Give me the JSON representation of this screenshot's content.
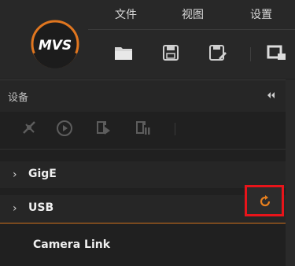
{
  "app": {
    "logo_text": "MVS"
  },
  "menu": {
    "file": "文件",
    "view": "视图",
    "settings": "设置"
  },
  "toolbar": {
    "icons": [
      "open-folder-icon",
      "save-icon",
      "save-as-icon",
      "window-icon"
    ]
  },
  "device_panel": {
    "title": "设备",
    "tools": [
      "disconnect-icon",
      "play-icon",
      "acquire-icon",
      "stop-acquire-icon"
    ],
    "tree": [
      {
        "label": "GigE",
        "expandable": true
      },
      {
        "label": "USB",
        "expandable": true,
        "selected": true
      },
      {
        "label": "Camera Link",
        "expandable": false
      }
    ]
  },
  "colors": {
    "accent": "#d0711c",
    "highlight_box": "#e8141a",
    "background": "#202020"
  }
}
